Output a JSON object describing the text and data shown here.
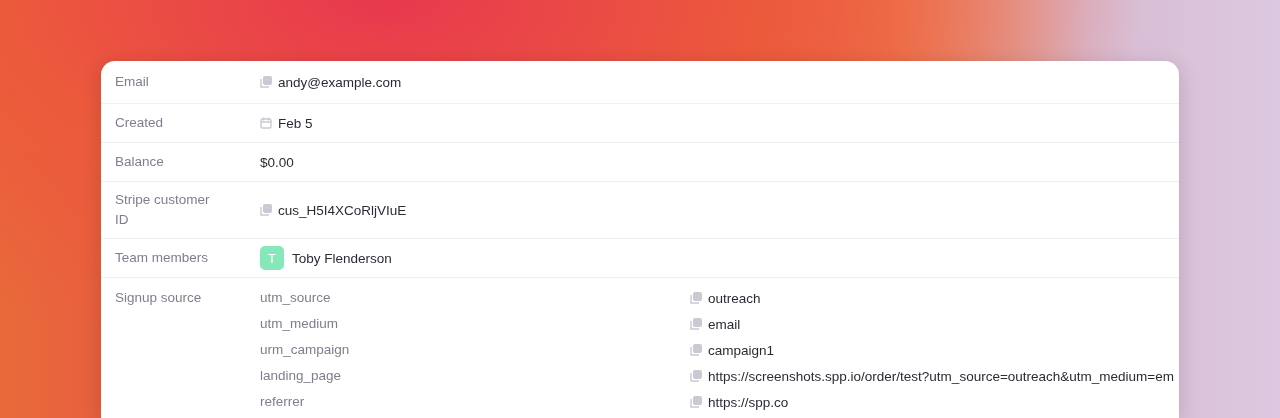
{
  "fields": [
    {
      "label": "Email",
      "kind": "copy",
      "value": "andy@example.com"
    },
    {
      "label": "Created",
      "kind": "date",
      "value": "Feb 5"
    },
    {
      "label": "Balance",
      "kind": "plain",
      "value": "$0.00"
    },
    {
      "label": "Stripe customer ID",
      "kind": "copy",
      "value": "cus_H5I4XCoRljVIuE"
    },
    {
      "label": "Team members",
      "kind": "members",
      "members": [
        {
          "initial": "T",
          "name": "Toby Flenderson",
          "color": "#86e8b8"
        }
      ]
    },
    {
      "label": "Signup source",
      "kind": "pairs",
      "pairs": [
        {
          "key": "utm_source",
          "value": "outreach"
        },
        {
          "key": "utm_medium",
          "value": "email"
        },
        {
          "key": "urm_campaign",
          "value": "campaign1"
        },
        {
          "key": "landing_page",
          "value": "https://screenshots.spp.io/order/test?utm_source=outreach&utm_medium=em"
        },
        {
          "key": "referrer",
          "value": "https://spp.co"
        }
      ]
    }
  ]
}
